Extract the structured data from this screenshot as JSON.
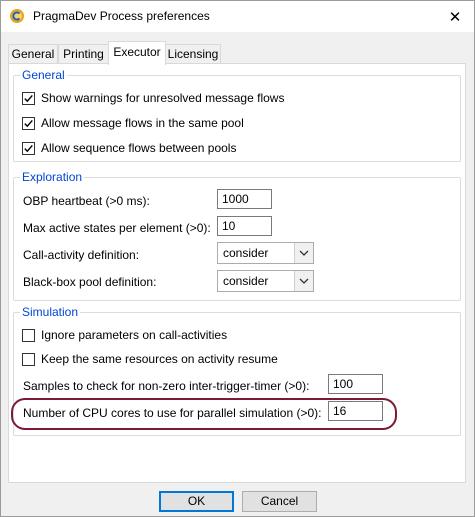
{
  "window": {
    "title": "PragmaDev Process preferences",
    "close_glyph": "✕"
  },
  "tabs": [
    {
      "label": "General"
    },
    {
      "label": "Printing"
    },
    {
      "label": "Executor"
    },
    {
      "label": "Licensing"
    }
  ],
  "active_tab": "Executor",
  "general_group": {
    "title": "General",
    "options": [
      {
        "label": "Show warnings for unresolved message flows",
        "checked": true
      },
      {
        "label": "Allow message flows in the same pool",
        "checked": true
      },
      {
        "label": "Allow sequence flows between pools",
        "checked": true
      }
    ]
  },
  "exploration_group": {
    "title": "Exploration",
    "obp_heartbeat": {
      "label": "OBP heartbeat (>0 ms):",
      "value": "1000"
    },
    "max_active_states": {
      "label": "Max active states per element (>0):",
      "value": "10"
    },
    "call_activity": {
      "label": "Call-activity definition:",
      "value": "consider"
    },
    "black_box_pool": {
      "label": "Black-box pool definition:",
      "value": "consider"
    }
  },
  "simulation_group": {
    "title": "Simulation",
    "options": [
      {
        "label": "Ignore parameters on call-activities",
        "checked": false
      },
      {
        "label": "Keep the same resources on activity resume",
        "checked": false
      }
    ],
    "samples": {
      "label": "Samples to check for non-zero inter-trigger-timer (>0):",
      "value": "100"
    },
    "cpu_cores": {
      "label": "Number of CPU cores to use for parallel simulation (>0):",
      "value": "16"
    }
  },
  "buttons": {
    "ok": "OK",
    "cancel": "Cancel"
  },
  "colors": {
    "group_title": "#0046d5",
    "highlight": "#7b1a32",
    "default_button_border": "#0078d7"
  },
  "icons": {
    "app": "pragmadev-gear-icon",
    "dropdown": "chevron-down-icon",
    "check": "check-icon"
  }
}
